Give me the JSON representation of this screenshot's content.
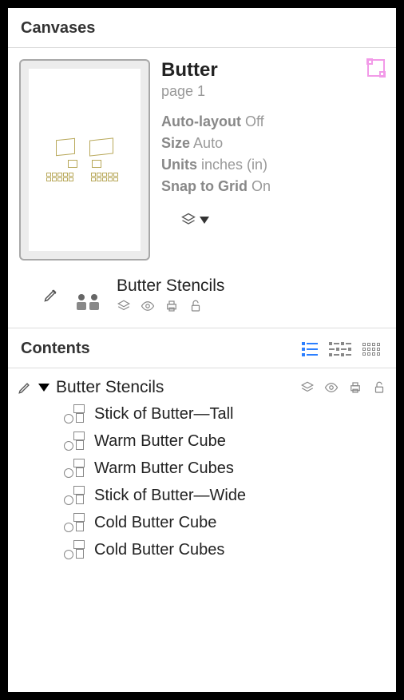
{
  "canvases": {
    "header": "Canvases",
    "canvas": {
      "title": "Butter",
      "subtitle": "page 1",
      "props": {
        "autolayout_label": "Auto-layout",
        "autolayout_value": "Off",
        "size_label": "Size",
        "size_value": "Auto",
        "units_label": "Units",
        "units_value": "inches (in)",
        "snap_label": "Snap to Grid",
        "snap_value": "On"
      }
    },
    "stencil": {
      "title": "Butter Stencils"
    }
  },
  "contents": {
    "header": "Contents",
    "root": "Butter Stencils",
    "items": [
      {
        "label": "Stick of Butter—Tall"
      },
      {
        "label": "Warm Butter Cube"
      },
      {
        "label": "Warm Butter Cubes"
      },
      {
        "label": "Stick of Butter—Wide"
      },
      {
        "label": "Cold Butter Cube"
      },
      {
        "label": "Cold Butter Cubes"
      }
    ]
  }
}
